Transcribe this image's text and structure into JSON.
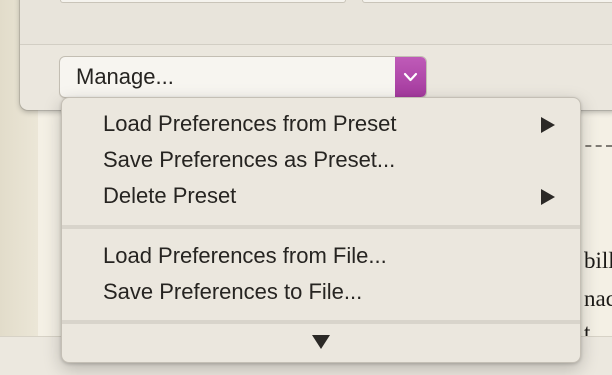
{
  "background_document": {
    "text_lines": [
      "bills",
      "nade",
      "t"
    ]
  },
  "manage_popup": {
    "label": "Manage...",
    "accent_color": "#b04aa9",
    "chevron_icon": "chevron-down-icon"
  },
  "menu": {
    "groups": [
      {
        "items": [
          {
            "label": "Load Preferences from Preset",
            "submenu": true
          },
          {
            "label": "Save Preferences as Preset...",
            "submenu": false
          },
          {
            "label": "Delete Preset",
            "submenu": true
          }
        ]
      },
      {
        "items": [
          {
            "label": "Load Preferences from File...",
            "submenu": false
          },
          {
            "label": "Save Preferences to File...",
            "submenu": false
          }
        ]
      }
    ],
    "scroll_indicator_icon": "scroll-down-arrow-icon"
  }
}
